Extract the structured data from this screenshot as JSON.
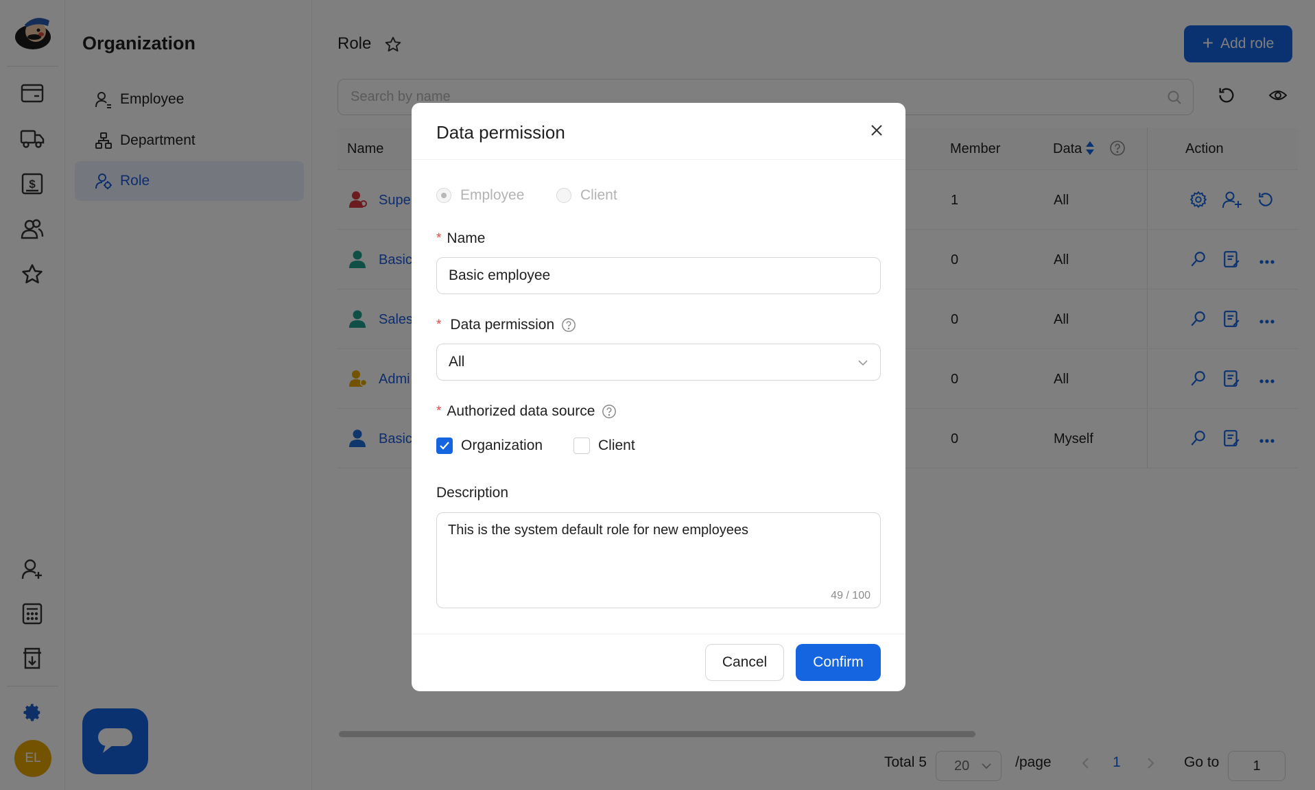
{
  "sidebar": {
    "avatar_initials": "EL",
    "icons": [
      "wallet-icon",
      "truck-icon",
      "billing-icon",
      "users-icon",
      "star-icon",
      "add-user-icon",
      "calculator-icon",
      "download-icon",
      "settings-icon"
    ]
  },
  "menu": {
    "title": "Organization",
    "items": [
      {
        "label": "Employee",
        "icon": "employee-icon"
      },
      {
        "label": "Department",
        "icon": "department-icon"
      },
      {
        "label": "Role",
        "icon": "role-icon",
        "active": true
      }
    ]
  },
  "page": {
    "title": "Role",
    "add_button": "Add role",
    "search_placeholder": "Search by name"
  },
  "table": {
    "headers": {
      "name": "Name",
      "member": "Member",
      "data": "Data",
      "action": "Action"
    },
    "rows": [
      {
        "name": "Supe",
        "member": "1",
        "data": "All",
        "icon_color": "#d9363e"
      },
      {
        "name": "Basic",
        "member": "0",
        "data": "All",
        "icon_color": "#1f9e8a"
      },
      {
        "name": "Sales",
        "member": "0",
        "data": "All",
        "icon_color": "#1f9e8a"
      },
      {
        "name": "Admi",
        "member": "0",
        "data": "All",
        "icon_color": "#e6a500"
      },
      {
        "name": "Basic",
        "member": "0",
        "data": "Myself",
        "icon_color": "#1f6fd8"
      }
    ]
  },
  "pagination": {
    "total": "Total 5",
    "page_size": "20",
    "per_page": "/page",
    "current": "1",
    "goto_label": "Go to",
    "goto_value": "1"
  },
  "modal": {
    "title": "Data permission",
    "type_options": [
      "Employee",
      "Client"
    ],
    "name_label": "Name",
    "name_value": "Basic employee",
    "data_permission_label": "Data permission",
    "data_permission_value": "All",
    "source_label": "Authorized data source",
    "source_options": [
      {
        "label": "Organization",
        "checked": true
      },
      {
        "label": "Client",
        "checked": false
      }
    ],
    "description_label": "Description",
    "description_value": "This is the system default role for new employees",
    "counter": "49 / 100",
    "cancel": "Cancel",
    "confirm": "Confirm"
  },
  "colors": {
    "primary": "#1565e0",
    "required": "#e5484d"
  }
}
